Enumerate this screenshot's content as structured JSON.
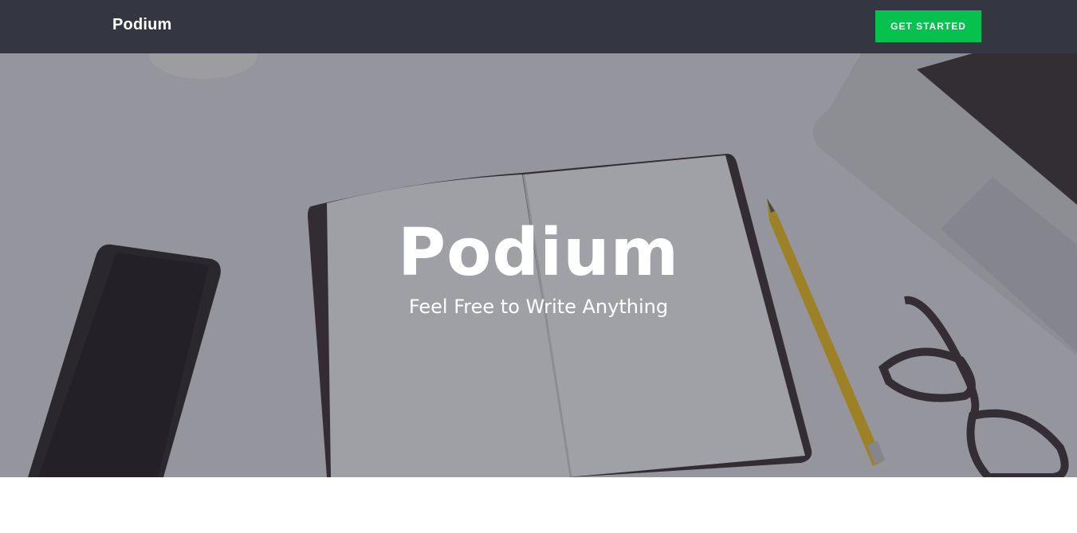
{
  "navbar": {
    "brand": "Podium",
    "cta_label": "GET STARTED"
  },
  "hero": {
    "title": "Podium",
    "subtitle": "Feel Free to Write Anything"
  },
  "colors": {
    "navbar_bg": "#343741",
    "cta_bg": "#05c14d",
    "hero_overlay": "#282838"
  },
  "icons": [
    "phone-image",
    "notebook-image",
    "pencil-image",
    "glasses-image",
    "laptop-image",
    "cup-image"
  ]
}
